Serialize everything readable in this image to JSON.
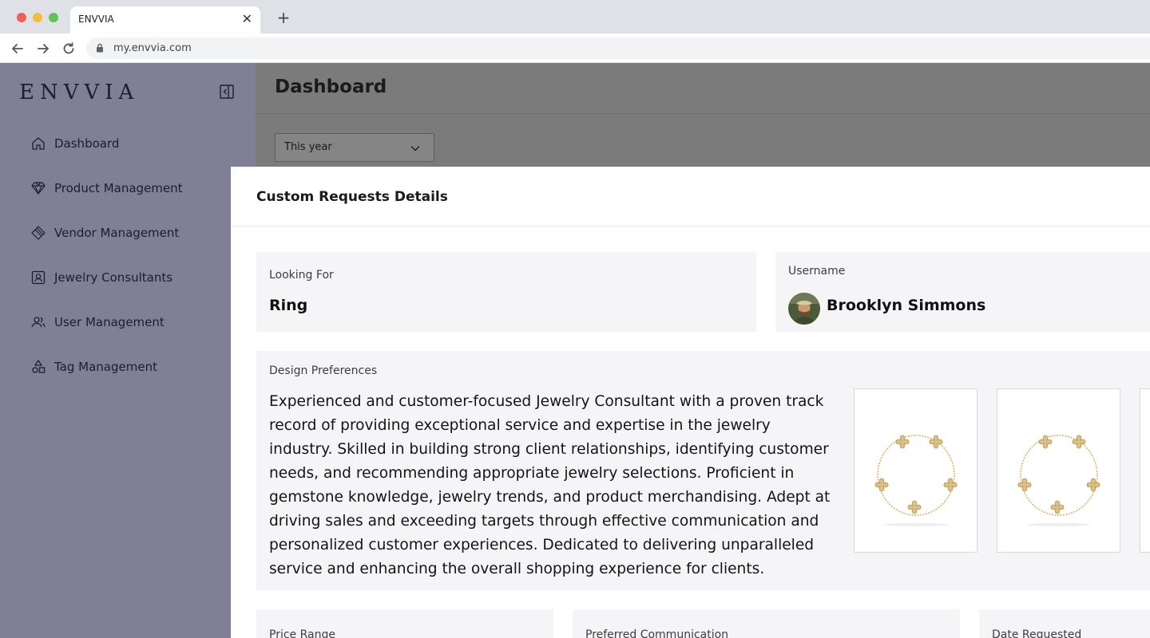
{
  "browser": {
    "tab_title": "ENVVIA",
    "tab_close": "✕",
    "new_tab": "+",
    "url": "my.envvia.com"
  },
  "sidebar": {
    "logo": "ENVVIA",
    "items": [
      {
        "label": "Dashboard",
        "icon": "home-icon"
      },
      {
        "label": "Product Management",
        "icon": "diamond-icon"
      },
      {
        "label": "Vendor Management",
        "icon": "tag-stack-icon"
      },
      {
        "label": "Jewelry Consultants",
        "icon": "id-card-icon"
      },
      {
        "label": "User Management",
        "icon": "users-icon"
      },
      {
        "label": "Tag Management",
        "icon": "shapes-icon"
      }
    ]
  },
  "main": {
    "title": "Dashboard",
    "period_select": "This year"
  },
  "modal": {
    "title": "Custom Requests Details",
    "looking_for": {
      "label": "Looking For",
      "value": "Ring"
    },
    "username": {
      "label": "Username",
      "value": "Brooklyn Simmons"
    },
    "design_preferences": {
      "label": "Design Preferences",
      "text": "Experienced and customer-focused Jewelry Consultant with a proven track record of providing exceptional service and expertise in the jewelry industry. Skilled in building strong client relationships, identifying customer needs, and recommending appropriate jewelry selections. Proficient in gemstone knowledge, jewelry trends, and product merchandising. Adept at driving sales and exceeding targets through effective communication and personalized customer experiences. Dedicated to delivering unparalleled service and enhancing the overall shopping experience for clients."
    },
    "price_range": {
      "label": "Price Range"
    },
    "preferred_communication": {
      "label": "Preferred Communication"
    },
    "date_requested": {
      "label": "Date Requested"
    }
  },
  "colors": {
    "sidebar_bg": "#7f7f95",
    "overlay_bg": "#7b7b7b",
    "card_bg": "#f5f5f7",
    "gold": "#d8b46a"
  }
}
